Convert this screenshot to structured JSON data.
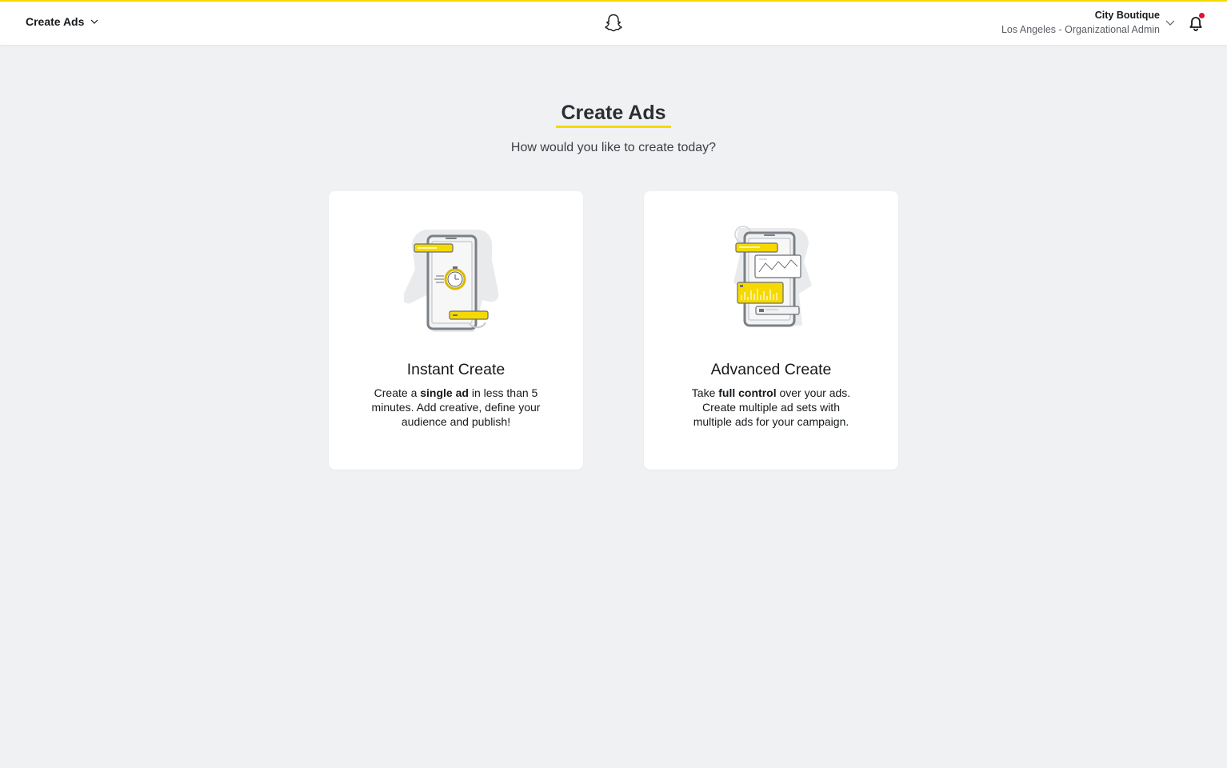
{
  "header": {
    "menu_label": "Create Ads",
    "account_name": "City Boutique",
    "account_sub": "Los Angeles - Organizational Admin",
    "brand_color": "#f6d900",
    "notification_dot_color": "#e0103a"
  },
  "main": {
    "title": "Create Ads",
    "subtitle": "How would you like to create today?"
  },
  "cards": [
    {
      "title": "Instant Create",
      "desc_pre": "Create a ",
      "desc_bold": "single ad",
      "desc_post": " in less than 5 minutes. Add creative, define your audience and publish!",
      "icon": "phone-stopwatch-illustration"
    },
    {
      "title": "Advanced Create",
      "desc_pre": "Take ",
      "desc_bold": "full control",
      "desc_post": " over your ads. Create multiple ad sets with multiple ads for your campaign.",
      "icon": "phone-analytics-illustration"
    }
  ]
}
